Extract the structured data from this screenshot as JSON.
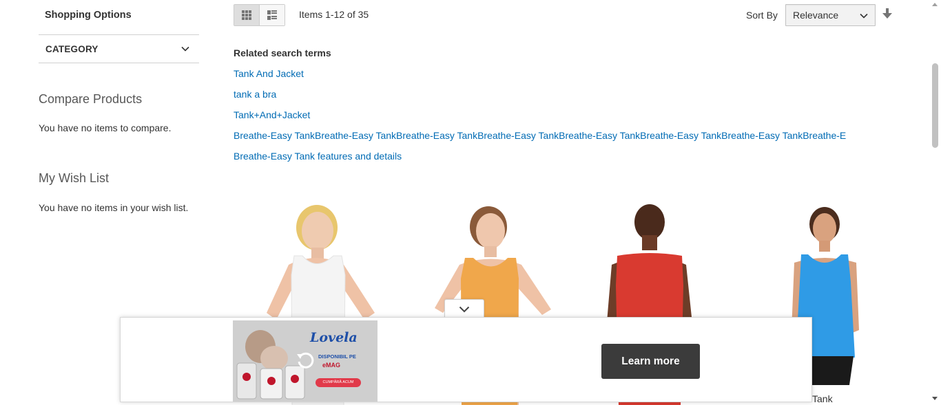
{
  "sidebar": {
    "shopping_options": "Shopping Options",
    "category_label": "CATEGORY",
    "compare_title": "Compare Products",
    "compare_empty": "You have no items to compare.",
    "wishlist_title": "My Wish List",
    "wishlist_empty": "You have no items in your wish list."
  },
  "toolbar": {
    "view_modes": [
      "grid",
      "list"
    ],
    "active_mode": "grid",
    "items_count": "Items 1-12 of 35",
    "sort_label": "Sort By",
    "sort_value": "Relevance",
    "sort_direction_icon": "arrow-down-icon"
  },
  "related": {
    "title": "Related search terms",
    "terms": [
      "Tank And Jacket",
      "tank a bra",
      "Tank+And+Jacket",
      "Breathe-Easy TankBreathe-Easy TankBreathe-Easy TankBreathe-Easy TankBreathe-Easy TankBreathe-Easy TankBreathe-Easy TankBreathe-E",
      "Breathe-Easy Tank features and details"
    ],
    "link_color": "#006bb4"
  },
  "products": [
    {
      "top_color": "#f4f4f4"
    },
    {
      "top_color": "#f0a74b"
    },
    {
      "top_color": "#d93a30"
    },
    {
      "top_color": "#2f9be6"
    }
  ],
  "product_visible_name": "Tank",
  "ad": {
    "brand": "Lovela",
    "line1": "DISPONIBIL PE",
    "line2": "eMAG",
    "small_cta": "CUMPĂRĂ ACUM",
    "learn_more": "Learn more",
    "toggle_icon": "chevron-down-icon",
    "replay_icon": "replay-icon"
  }
}
